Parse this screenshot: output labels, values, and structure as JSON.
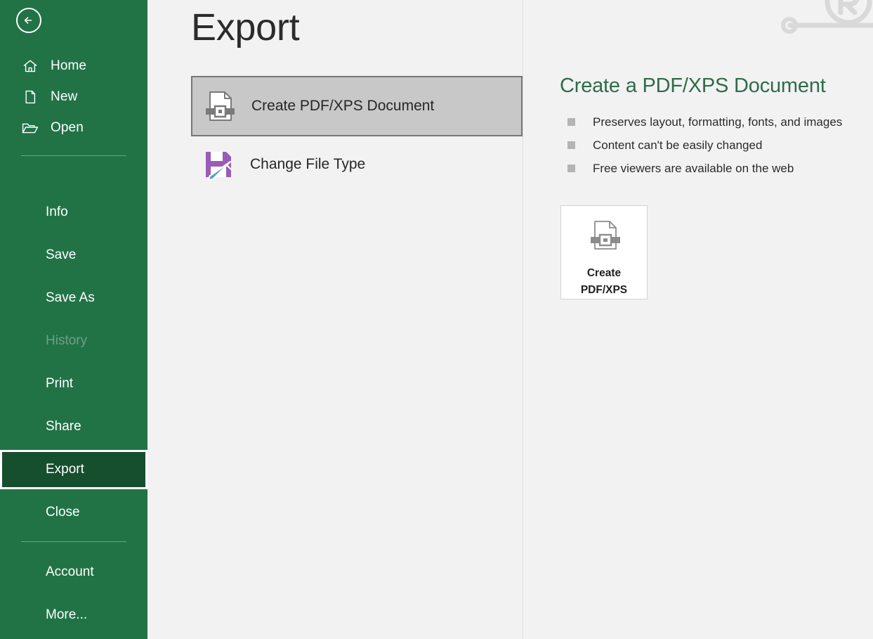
{
  "sidebar": {
    "back_button": {
      "name": "Back",
      "icon": "back-arrow-icon"
    },
    "top_items": [
      {
        "label": "Home",
        "icon": "home-icon"
      },
      {
        "label": "New",
        "icon": "new-document-icon"
      },
      {
        "label": "Open",
        "icon": "open-folder-icon"
      }
    ],
    "items": [
      {
        "label": "Info",
        "state": "normal"
      },
      {
        "label": "Save",
        "state": "normal"
      },
      {
        "label": "Save As",
        "state": "normal"
      },
      {
        "label": "History",
        "state": "disabled"
      },
      {
        "label": "Print",
        "state": "normal"
      },
      {
        "label": "Share",
        "state": "normal"
      },
      {
        "label": "Export",
        "state": "selected"
      },
      {
        "label": "Close",
        "state": "normal"
      },
      {
        "label": "Account",
        "state": "normal"
      },
      {
        "label": "More...",
        "state": "normal"
      }
    ],
    "colors": {
      "background": "#217346",
      "selected_background": "#164f2e",
      "selected_border": "#ffffff",
      "text": "#ffffff",
      "disabled_text": "#6f9e86",
      "separator": "#65a383"
    }
  },
  "header": {
    "title": "Export"
  },
  "options": [
    {
      "label": "Create PDF/XPS Document",
      "icon": "pdf-document-icon",
      "state": "selected"
    },
    {
      "label": "Change File Type",
      "icon": "save-pencil-icon",
      "state": "normal"
    }
  ],
  "detail": {
    "title": "Create a PDF/XPS Document",
    "bullets": [
      "Preserves layout, formatting, fonts, and images",
      "Content can't be easily changed",
      "Free viewers are available on the web"
    ],
    "button": {
      "line1": "Create",
      "line2": "PDF/XPS",
      "icon": "pdf-document-icon"
    },
    "colors": {
      "title": "#2f6b4a",
      "bullet_square": "#b4b4b4",
      "body_text": "#2b2b2b"
    }
  },
  "theme": {
    "content_background": "#f2f2f2",
    "option_selected_background": "#c8c8c8",
    "option_selected_border": "#767676",
    "divider": "#e0e0e0",
    "page_title_color": "#2b2b2b"
  },
  "decoration": {
    "watermark": "circled-glyph-watermark"
  }
}
